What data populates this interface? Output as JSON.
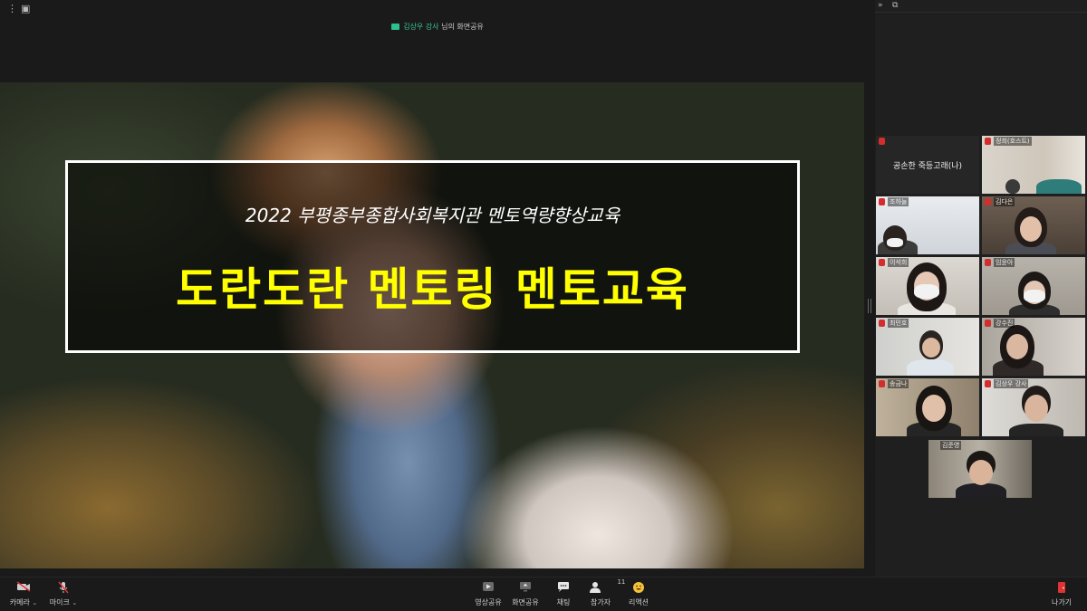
{
  "topbar": {
    "more_icon": "⋮",
    "window_icon": "▣"
  },
  "share_banner": {
    "presenter": "김상우 강사",
    "suffix": "님의 화면공유"
  },
  "slide": {
    "subtitle": "2022 부평종부종합사회복지관 멘토역량향상교육",
    "title": "도란도란 멘토링 멘토교육"
  },
  "panel": {
    "collapse_icon": "»",
    "popout_icon": "⧉"
  },
  "participants": [
    {
      "name": "",
      "center_label": "공손한 죽등고래(나)"
    },
    {
      "name": "정희(호스트)"
    },
    {
      "name": "조하늘"
    },
    {
      "name": "김다은"
    },
    {
      "name": "이석희"
    },
    {
      "name": "임윤아"
    },
    {
      "name": "최민호"
    },
    {
      "name": "강수진"
    },
    {
      "name": "송금나"
    },
    {
      "name": "김상우 강사"
    },
    {
      "name": "김준영"
    }
  ],
  "toolbar": {
    "camera": "카메라",
    "mic": "마이크",
    "video_share": "영상공유",
    "screen_share": "화면공유",
    "chat": "채팅",
    "participants": "참가자",
    "participant_count": "11",
    "reaction": "리액션",
    "leave": "나가기"
  },
  "colors": {
    "accent_green": "#39c79a",
    "title_yellow": "#ffff00",
    "mic_red": "#d42d2d",
    "leave_red": "#e03333"
  }
}
